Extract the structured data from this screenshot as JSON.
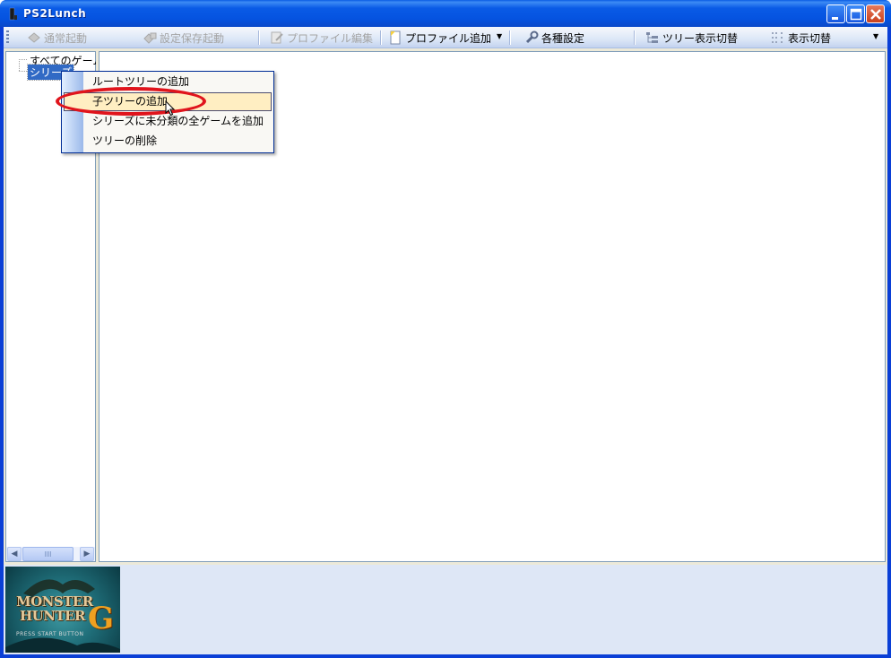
{
  "window": {
    "title": "PS2Lunch",
    "controls": [
      "minimize",
      "maximize",
      "close"
    ]
  },
  "toolbar": {
    "items": [
      {
        "label": "通常起動",
        "icon": "play-icon",
        "enabled": false
      },
      {
        "label": "設定保存起動",
        "icon": "save-launch-icon",
        "enabled": false
      },
      {
        "label": "プロファイル編集",
        "icon": "edit-icon",
        "enabled": false
      },
      {
        "label": "プロファイル追加",
        "icon": "new-doc-icon",
        "enabled": true,
        "dropdown": true
      },
      {
        "label": "各種設定",
        "icon": "wrench-icon",
        "enabled": true
      },
      {
        "label": "ツリー表示切替",
        "icon": "tree-icon",
        "enabled": true
      },
      {
        "label": "表示切替",
        "icon": "view-icon",
        "enabled": true,
        "dropdown": true
      }
    ]
  },
  "tree": {
    "items": [
      {
        "label": "すべてのゲーム",
        "selected": false
      },
      {
        "label": "シリーズ",
        "selected": true
      }
    ]
  },
  "context_menu": {
    "items": [
      {
        "label": "ルートツリーの追加",
        "hover": false
      },
      {
        "label": "子ツリーの追加",
        "hover": true
      },
      {
        "label": "シリーズに未分類の全ゲームを追加",
        "hover": false
      },
      {
        "label": "ツリーの削除",
        "hover": false
      }
    ]
  },
  "cover": {
    "line1": "MONSTER",
    "line2": "HUNTER",
    "letter": "G",
    "subtitle": "PRESS START BUTTON"
  },
  "colors": {
    "titlebar": "#0553e0",
    "selection": "#316ac5",
    "menu_hover": "#ffeec2",
    "annotation": "#e0141c"
  }
}
